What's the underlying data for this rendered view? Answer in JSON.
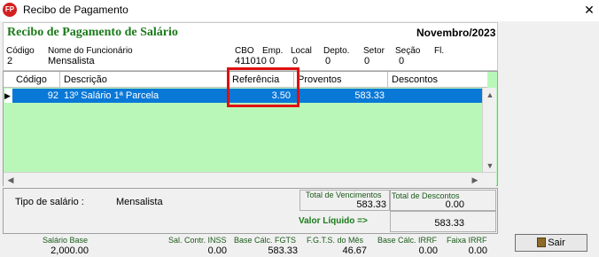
{
  "window": {
    "title": "Recibo de Pagamento",
    "app_icon": "FP"
  },
  "header": {
    "title": "Recibo de Pagamento de Salário",
    "month": "Novembro/2023",
    "fields": {
      "codigo_label": "Código",
      "codigo": "2",
      "nome_label": "Nome do Funcionário",
      "nome": "Mensalista",
      "cbo_label": "CBO",
      "cbo": "411010",
      "emp_label": "Emp.",
      "emp": "0",
      "local_label": "Local",
      "local": "0",
      "depto_label": "Depto.",
      "depto": "0",
      "setor_label": "Setor",
      "setor": "0",
      "secao_label": "Seção",
      "secao": "0",
      "fl_label": "Fl."
    }
  },
  "grid": {
    "columns": [
      "Código",
      "Descrição",
      "Referência",
      "Proventos",
      "Descontos"
    ],
    "rows": [
      {
        "codigo": "92",
        "descricao": "13º Salário 1ª Parcela",
        "referencia": "3.50",
        "proventos": "583.33",
        "descontos": ""
      }
    ]
  },
  "info": {
    "tipo_label": "Tipo de salário :",
    "tipo_value": "Mensalista",
    "total_vencimentos_label": "Total de Vencimentos",
    "total_vencimentos": "583.33",
    "total_descontos_label": "Total de Descontos",
    "total_descontos": "0.00",
    "valor_liquido_label": "Valor Líquido  =>",
    "valor_liquido": "583.33"
  },
  "footer": {
    "salario_base_label": "Salário Base",
    "salario_base": "2,000.00",
    "sal_contr_inss_label": "Sal. Contr. INSS",
    "sal_contr_inss": "0.00",
    "base_calc_fgts_label": "Base Cálc. FGTS",
    "base_calc_fgts": "583.33",
    "fgts_mes_label": "F.G.T.S. do Mês",
    "fgts_mes": "46.67",
    "base_calc_irrf_label": "Base Cálc. IRRF",
    "base_calc_irrf": "0.00",
    "faixa_irrf_label": "Faixa IRRF",
    "faixa_irrf": "0.00"
  },
  "buttons": {
    "sair": "Sair"
  },
  "colors": {
    "grid_bg": "#b9f7b9",
    "selected_row": "#0a78d7",
    "title_green": "#1a7a1a",
    "highlight": "#e01010"
  }
}
